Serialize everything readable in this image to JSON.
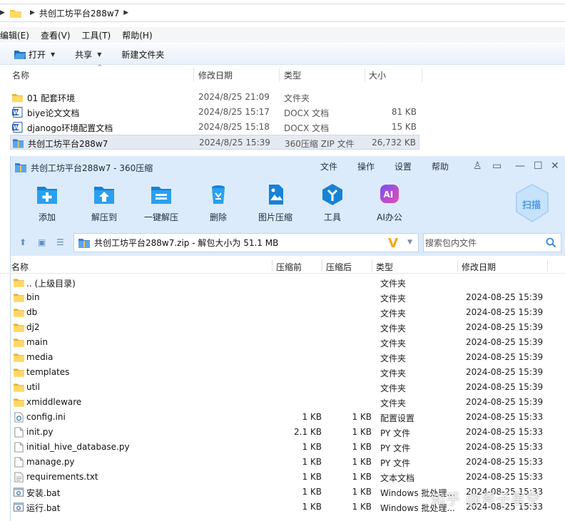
{
  "explorer": {
    "address": "共创工坊平台288w7",
    "menu": [
      "编辑(E)",
      "查看(V)",
      "工具(T)",
      "帮助(H)"
    ],
    "commands": {
      "open": "打开",
      "share": "共享",
      "new_folder": "新建文件夹"
    },
    "columns": {
      "name": "名称",
      "date": "修改日期",
      "type": "类型",
      "size": "大小"
    },
    "rows": [
      {
        "name": "01 配套环境",
        "date": "2024/8/25 21:09",
        "type": "文件夹",
        "size": "",
        "icon": "folder-icon"
      },
      {
        "name": "biye论文文档",
        "date": "2024/8/25 15:17",
        "type": "DOCX 文档",
        "size": "81 KB",
        "icon": "word-doc-icon"
      },
      {
        "name": "djanogo环境配置文档",
        "date": "2024/8/25 15:18",
        "type": "DOCX 文档",
        "size": "15 KB",
        "icon": "word-doc-icon"
      },
      {
        "name": "共创工坊平台288w7",
        "date": "2024/8/25 15:39",
        "type": "360压缩 ZIP 文件",
        "size": "26,732 KB",
        "icon": "zip-archive-icon"
      }
    ]
  },
  "zip": {
    "title": "共创工坊平台288w7 - 360压缩",
    "menu": [
      "文件",
      "操作",
      "设置",
      "帮助"
    ],
    "tools": [
      {
        "label": "添加",
        "icon": "add-icon"
      },
      {
        "label": "解压到",
        "icon": "extract-to-icon"
      },
      {
        "label": "一键解压",
        "icon": "one-click-extract-icon"
      },
      {
        "label": "删除",
        "icon": "delete-icon"
      },
      {
        "label": "图片压缩",
        "icon": "image-compress-icon"
      },
      {
        "label": "工具",
        "icon": "tools-icon"
      },
      {
        "label": "AI办公",
        "icon": "ai-office-icon"
      }
    ],
    "scan_label": "扫描",
    "path": "共创工坊平台288w7.zip - 解包大小为 51.1 MB",
    "search_placeholder": "搜索包内文件",
    "columns": {
      "name": "名称",
      "before": "压缩前",
      "after": "压缩后",
      "type": "类型",
      "date": "修改日期"
    },
    "rows": [
      {
        "name": ".. (上级目录)",
        "before": "",
        "after": "",
        "type": "文件夹",
        "date": "",
        "icon": "folder-icon"
      },
      {
        "name": "bin",
        "before": "",
        "after": "",
        "type": "文件夹",
        "date": "2024-08-25 15:39",
        "icon": "folder-icon"
      },
      {
        "name": "db",
        "before": "",
        "after": "",
        "type": "文件夹",
        "date": "2024-08-25 15:39",
        "icon": "folder-icon"
      },
      {
        "name": "dj2",
        "before": "",
        "after": "",
        "type": "文件夹",
        "date": "2024-08-25 15:39",
        "icon": "folder-icon"
      },
      {
        "name": "main",
        "before": "",
        "after": "",
        "type": "文件夹",
        "date": "2024-08-25 15:39",
        "icon": "folder-icon"
      },
      {
        "name": "media",
        "before": "",
        "after": "",
        "type": "文件夹",
        "date": "2024-08-25 15:39",
        "icon": "folder-icon"
      },
      {
        "name": "templates",
        "before": "",
        "after": "",
        "type": "文件夹",
        "date": "2024-08-25 15:39",
        "icon": "folder-icon"
      },
      {
        "name": "util",
        "before": "",
        "after": "",
        "type": "文件夹",
        "date": "2024-08-25 15:39",
        "icon": "folder-icon"
      },
      {
        "name": "xmiddleware",
        "before": "",
        "after": "",
        "type": "文件夹",
        "date": "2024-08-25 15:39",
        "icon": "folder-icon"
      },
      {
        "name": "config.ini",
        "before": "1 KB",
        "after": "1 KB",
        "type": "配置设置",
        "date": "2024-08-25 15:33",
        "icon": "settings-file-icon"
      },
      {
        "name": "init.py",
        "before": "2.1 KB",
        "after": "1 KB",
        "type": "PY 文件",
        "date": "2024-08-25 15:33",
        "icon": "file-icon"
      },
      {
        "name": "initial_hive_database.py",
        "before": "1 KB",
        "after": "1 KB",
        "type": "PY 文件",
        "date": "2024-08-25 15:33",
        "icon": "file-icon"
      },
      {
        "name": "manage.py",
        "before": "1 KB",
        "after": "1 KB",
        "type": "PY 文件",
        "date": "2024-08-25 15:33",
        "icon": "file-icon"
      },
      {
        "name": "requirements.txt",
        "before": "1 KB",
        "after": "1 KB",
        "type": "文本文档",
        "date": "2024-08-25 15:33",
        "icon": "text-file-icon"
      },
      {
        "name": "安装.bat",
        "before": "1 KB",
        "after": "1 KB",
        "type": "Windows 批处理...",
        "date": "2024-08-25 15:33",
        "icon": "bat-file-icon"
      },
      {
        "name": "运行.bat",
        "before": "1 KB",
        "after": "1 KB",
        "type": "Windows 批处理...",
        "date": "2024-08-25 15:33",
        "icon": "bat-file-icon"
      }
    ]
  },
  "watermark": "知乎 @斧子星空",
  "colors": {
    "zip_chrome": "#dcebfb",
    "accent_blue": "#1a8ad9",
    "folder": "#f5c342",
    "selected_row": "#e5eaf2"
  }
}
